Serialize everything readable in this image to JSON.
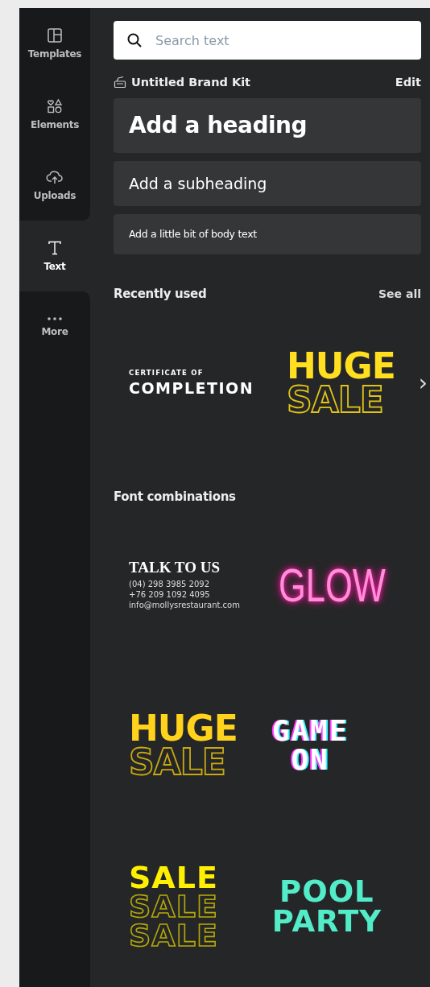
{
  "sidebar": {
    "items": [
      {
        "label": "Templates",
        "kind": "templates",
        "selected": false
      },
      {
        "label": "Elements",
        "kind": "elements",
        "selected": false
      },
      {
        "label": "Uploads",
        "kind": "uploads",
        "selected": false
      },
      {
        "label": "Text",
        "kind": "text",
        "selected": true
      },
      {
        "label": "More",
        "kind": "more",
        "selected": false
      }
    ]
  },
  "search": {
    "placeholder": "Search text"
  },
  "brand_kit": {
    "name": "Untitled Brand Kit",
    "action": "Edit"
  },
  "text_buttons": [
    {
      "kind": "heading",
      "label": "Add a heading"
    },
    {
      "kind": "subheading",
      "label": "Add a subheading"
    },
    {
      "kind": "body",
      "label": "Add a little bit of body text"
    }
  ],
  "recently_used": {
    "title": "Recently used",
    "action": "See all",
    "next": "›",
    "tiles": [
      {
        "kind": "certificate",
        "lines": [
          "CERTIFICATE OF",
          "COMPLETION"
        ]
      },
      {
        "kind": "huge-sale",
        "lines": [
          "HUGE",
          "SALE"
        ]
      }
    ]
  },
  "font_combinations": {
    "title": "Font combinations",
    "tiles": [
      {
        "kind": "talk",
        "lines": [
          "TALK TO US",
          "(04) 298 3985 2092",
          "+76 209 1092 4095",
          "info@mollysrestaurant.com"
        ]
      },
      {
        "kind": "glow",
        "lines": [
          "GLOW"
        ]
      },
      {
        "kind": "huge-sale",
        "lines": [
          "HUGE",
          "SALE"
        ]
      },
      {
        "kind": "game",
        "lines": [
          "GAME",
          "ON"
        ]
      },
      {
        "kind": "sale-stack",
        "lines": [
          "SALE",
          "SALE",
          "SALE"
        ]
      },
      {
        "kind": "pool",
        "lines": [
          "POOL",
          "PARTY"
        ]
      }
    ]
  }
}
